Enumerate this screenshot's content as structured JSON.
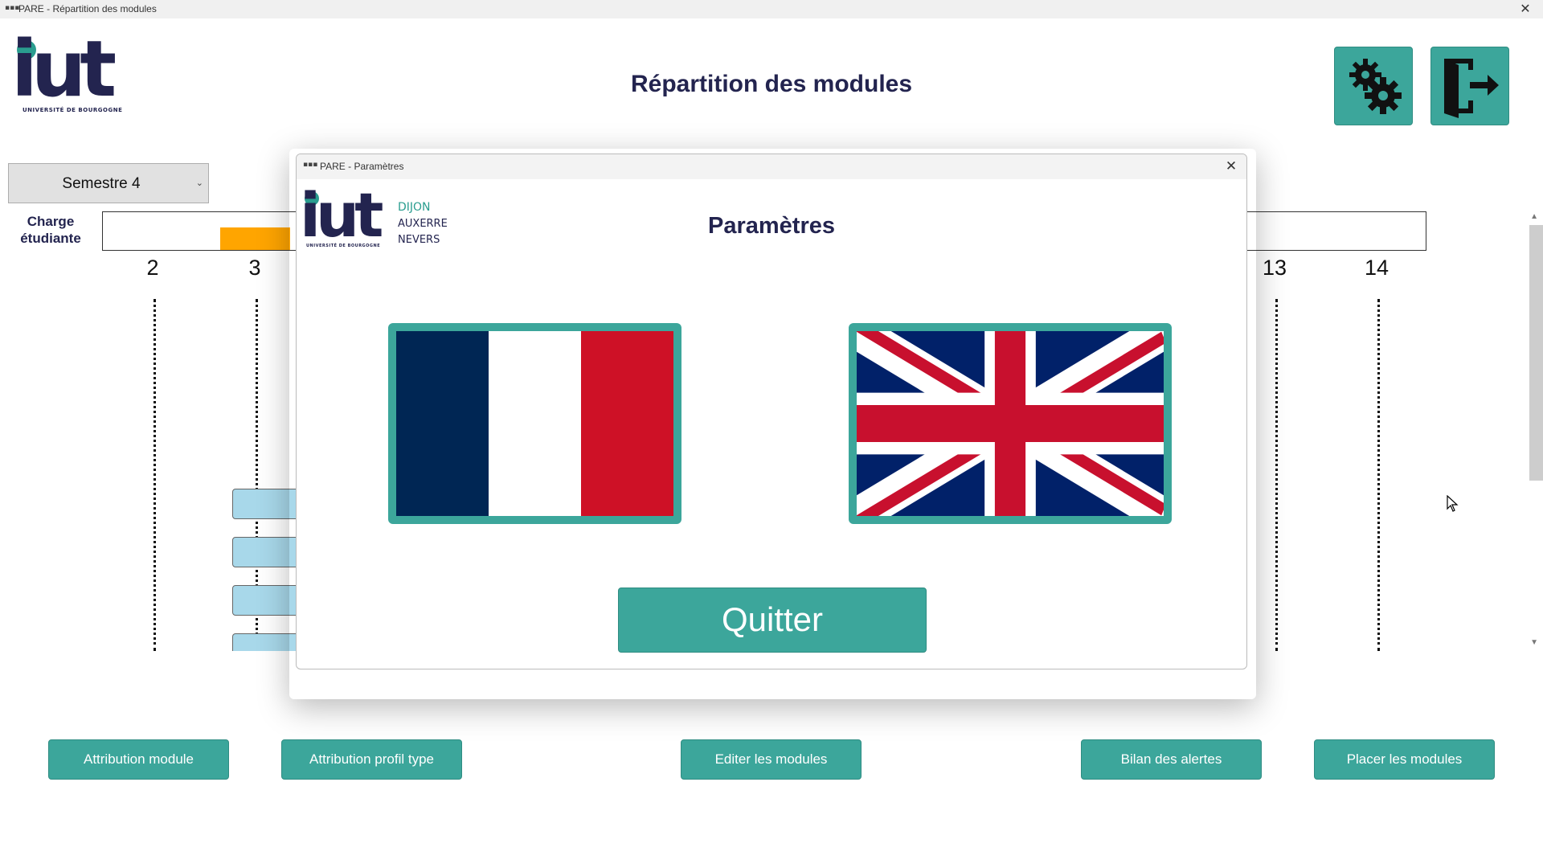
{
  "main_window": {
    "title": "PARE - Répartition des modules",
    "close_glyph": "✕"
  },
  "logo": {
    "text": "iut",
    "subtitle": "UNIVERSITÉ DE BOURGOGNE"
  },
  "page_title": "Répartition des modules",
  "header_buttons": {
    "settings_icon": "gears-icon",
    "exit_icon": "exit-door-icon"
  },
  "semester_select": {
    "value": "Semestre 4"
  },
  "charge_label": {
    "line1": "Charge",
    "line2": "étudiante"
  },
  "weeks": [
    {
      "label": "2"
    },
    {
      "label": "3"
    },
    {
      "label": "13"
    },
    {
      "label": "14"
    }
  ],
  "bottom_buttons": {
    "attribution_module": "Attribution module",
    "attribution_profil": "Attribution profil type",
    "editer_modules": "Editer les modules",
    "bilan_alertes": "Bilan des alertes",
    "placer_modules": "Placer les modules"
  },
  "dialog": {
    "title_bar": "PARE - Paramètres",
    "heading": "Paramètres",
    "logo_text": "iut",
    "logo_subtitle": "UNIVERSITÉ DE BOURGOGNE",
    "campuses": [
      "DIJON",
      "AUXERRE",
      "NEVERS"
    ],
    "flags": {
      "french": "france-flag",
      "english": "uk-flag"
    },
    "quit_label": "Quitter",
    "close_glyph": "✕"
  },
  "colors": {
    "accent": "#3ca69b",
    "brand_navy": "#23244f",
    "charge_fill": "#ffa500",
    "module_box": "#a8d8ea"
  }
}
